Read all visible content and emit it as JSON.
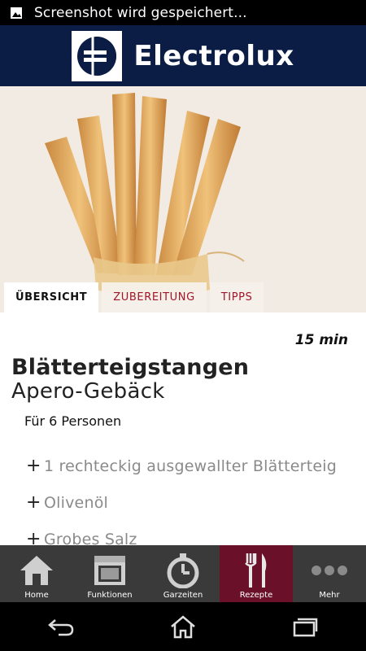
{
  "status_bar": {
    "text": "Screenshot wird gespeichert..."
  },
  "brand": {
    "name": "Electrolux"
  },
  "hero": {
    "tabs": [
      {
        "label": "ÜBERSICHT",
        "active": true
      },
      {
        "label": "ZUBEREITUNG",
        "active": false
      },
      {
        "label": "TIPPS",
        "active": false
      }
    ]
  },
  "recipe": {
    "duration": "15 min",
    "title": "Blätterteigstangen",
    "subtitle": "Apero-Gebäck",
    "servings": "Für 6 Personen",
    "ingredients": [
      "1 rechteckig ausgewallter Blätterteig",
      "Olivenöl",
      "Grobes Salz"
    ],
    "ingredient_prefix": "+"
  },
  "bottom_nav": {
    "items": [
      {
        "label": "Home",
        "icon": "home-icon",
        "active": false
      },
      {
        "label": "Funktionen",
        "icon": "oven-icon",
        "active": false
      },
      {
        "label": "Garzeiten",
        "icon": "timer-icon",
        "active": false
      },
      {
        "label": "Rezepte",
        "icon": "fork-knife-icon",
        "active": true
      },
      {
        "label": "Mehr",
        "icon": "more-icon",
        "active": false
      }
    ]
  },
  "colors": {
    "brand_navy": "#0b1d44",
    "accent_red": "#a0152a",
    "nav_active": "#6a1029",
    "nav_bg": "#3a3a3a"
  }
}
